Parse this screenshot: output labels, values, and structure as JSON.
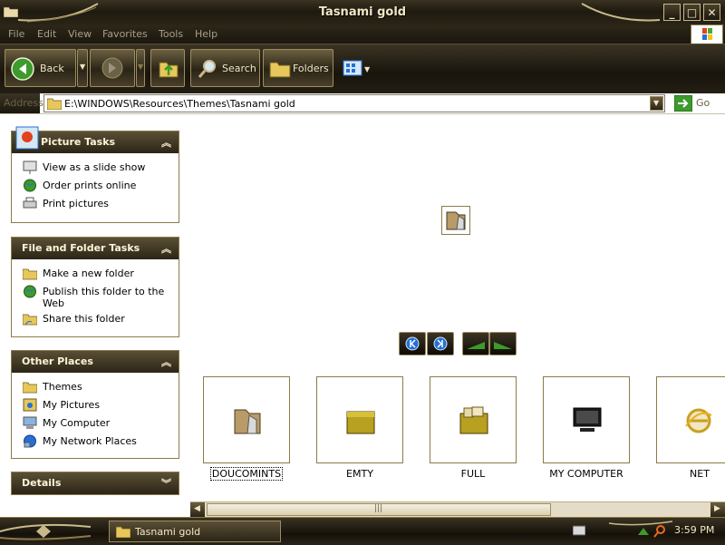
{
  "window": {
    "title": "Tasnami gold"
  },
  "menu": [
    "File",
    "Edit",
    "View",
    "Favorites",
    "Tools",
    "Help"
  ],
  "toolbar": {
    "back": "Back",
    "search": "Search",
    "folders": "Folders"
  },
  "address": {
    "label": "Address",
    "path": "E:\\WINDOWS\\Resources\\Themes\\Tasnami gold",
    "go": "Go"
  },
  "sidebar": {
    "picture_tasks": {
      "title": "Picture Tasks",
      "items": [
        "View as a slide show",
        "Order prints online",
        "Print pictures"
      ]
    },
    "file_tasks": {
      "title": "File and Folder Tasks",
      "items": [
        "Make a new folder",
        "Publish this folder to the Web",
        "Share this folder"
      ]
    },
    "other_places": {
      "title": "Other Places",
      "items": [
        "Themes",
        "My Pictures",
        "My Computer",
        "My Network Places"
      ]
    },
    "details": {
      "title": "Details"
    }
  },
  "thumbnails": [
    "DOUCOMINTS",
    "EMTY",
    "FULL",
    "MY COMPUTER",
    "NET"
  ],
  "taskbar": {
    "window": "Tasnami gold",
    "clock": "3:59 PM"
  },
  "colors": {
    "chrome": "#2b2517",
    "gold": "#8c7a4a",
    "cream": "#f2e6c4"
  }
}
